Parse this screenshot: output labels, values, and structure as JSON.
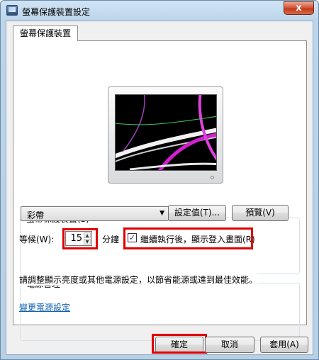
{
  "window": {
    "title": "螢幕保護裝置設定",
    "close_glyph": "x"
  },
  "tab": {
    "label": "螢幕保護裝置"
  },
  "screensaver": {
    "group_label": "螢幕保護裝置(S)",
    "selected": "彩帶",
    "settings_button": "設定值(T)...",
    "preview_button": "預覽(V)",
    "wait_label": "等候(W):",
    "wait_value": "15",
    "minutes_label": "分鐘",
    "resume_checkbox_label": "繼續執行後，顯示登入畫面(R)",
    "resume_checked": true
  },
  "power": {
    "group_label": "電源管理",
    "description": "請調整顯示亮度或其他電源設定，以節省能源或達到最佳效能。",
    "link_label": "變更電源設定"
  },
  "footer": {
    "ok_button": "確定",
    "cancel_button": "取消",
    "apply_button": "套用(A)"
  },
  "highlight_color": "#e00000"
}
